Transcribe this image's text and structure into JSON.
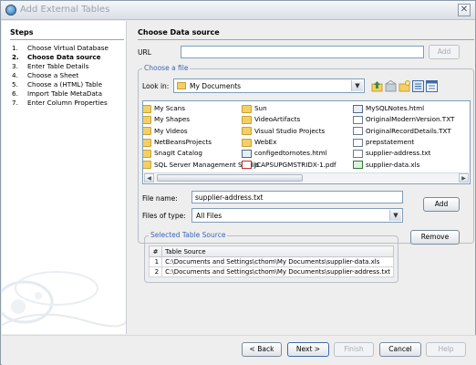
{
  "window": {
    "title": "Add External Tables",
    "close_glyph": "✕"
  },
  "steps": {
    "title": "Steps",
    "items": [
      {
        "num": "1.",
        "label": "Choose Virtual Database",
        "active": false
      },
      {
        "num": "2.",
        "label": "Choose Data source",
        "active": true
      },
      {
        "num": "3.",
        "label": "Enter Table Details",
        "active": false
      },
      {
        "num": "4.",
        "label": "Choose a Sheet",
        "active": false
      },
      {
        "num": "5.",
        "label": "Choose a (HTML) Table",
        "active": false
      },
      {
        "num": "6.",
        "label": "Import Table MetaData",
        "active": false
      },
      {
        "num": "7.",
        "label": "Enter Column Properties",
        "active": false
      }
    ]
  },
  "content": {
    "title": "Choose Data source",
    "url": {
      "label": "URL",
      "value": "",
      "add_label": "Add"
    },
    "choose_file": {
      "legend": "Choose a file",
      "look_in_label": "Look in:",
      "look_in_value": "My Documents",
      "icons": [
        "up-folder-icon",
        "home-folder-icon",
        "new-folder-icon",
        "list-view-icon",
        "details-view-icon"
      ],
      "files": {
        "col1": [
          {
            "name": "My Scans",
            "icon": "folder-icon"
          },
          {
            "name": "My Shapes",
            "icon": "folder-icon"
          },
          {
            "name": "My Videos",
            "icon": "folder-icon"
          },
          {
            "name": "NetBeansProjects",
            "icon": "folder-icon"
          },
          {
            "name": "SnagIt Catalog",
            "icon": "folder-icon"
          },
          {
            "name": "SQL Server Management Studio",
            "icon": "folder-icon"
          }
        ],
        "col2": [
          {
            "name": "Sun",
            "icon": "folder-icon"
          },
          {
            "name": "VideoArtifacts",
            "icon": "folder-icon"
          },
          {
            "name": "Visual Studio Projects",
            "icon": "folder-icon"
          },
          {
            "name": "WebEx",
            "icon": "folder-icon"
          },
          {
            "name": "configedtornotes.html",
            "icon": "html-file-icon"
          },
          {
            "name": "JCAPSUPGMSTRIDX-1.pdf",
            "icon": "pdf-file-icon"
          }
        ],
        "col3": [
          {
            "name": "MySQLNotes.html",
            "icon": "html-file-icon"
          },
          {
            "name": "OriginalModernVersion.TXT",
            "icon": "text-file-icon"
          },
          {
            "name": "OriginalRecordDetails.TXT",
            "icon": "text-file-icon"
          },
          {
            "name": "prepstatement",
            "icon": "text-file-icon"
          },
          {
            "name": "supplier-address.txt",
            "icon": "text-file-icon"
          },
          {
            "name": "supplier-data.xls",
            "icon": "excel-file-icon"
          }
        ]
      },
      "file_name_label": "File name:",
      "file_name_value": "supplier-address.txt",
      "files_of_type_label": "Files of type:",
      "files_of_type_value": "All Files",
      "add_label": "Add"
    },
    "selected": {
      "legend": "Selected Table Source",
      "remove_label": "Remove",
      "headers": [
        "#",
        "Table Source"
      ],
      "rows": [
        [
          "1",
          "C:\\Documents and Settings\\cthom\\My Documents\\supplier-data.xls"
        ],
        [
          "2",
          "C:\\Documents and Settings\\cthom\\My Documents\\supplier-address.txt"
        ]
      ]
    }
  },
  "footer": {
    "back": "< Back",
    "next": "Next >",
    "finish": "Finish",
    "cancel": "Cancel",
    "help": "Help"
  }
}
